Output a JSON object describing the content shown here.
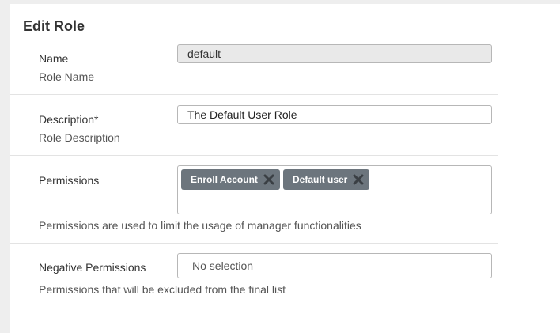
{
  "form": {
    "title": "Edit Role",
    "name": {
      "label": "Name",
      "hint": "Role Name",
      "value": "default"
    },
    "description": {
      "label": "Description*",
      "hint": "Role Description",
      "value": "The Default User Role"
    },
    "permissions": {
      "label": "Permissions",
      "hint": "Permissions are used to limit the usage of manager functionalities",
      "tags": [
        {
          "label": "Enroll Account",
          "remove_icon": "close-icon"
        },
        {
          "label": "Default user",
          "remove_icon": "close-icon"
        }
      ]
    },
    "negative_permissions": {
      "label": "Negative Permissions",
      "hint": "Permissions that will be excluded from the final list",
      "placeholder": "No selection"
    }
  },
  "colors": {
    "page_background": "#eeeeee",
    "card_background": "#ffffff",
    "tag_background": "#6c757d",
    "disabled_input": "#e9e9e9",
    "input_border": "#b7b7b7"
  }
}
